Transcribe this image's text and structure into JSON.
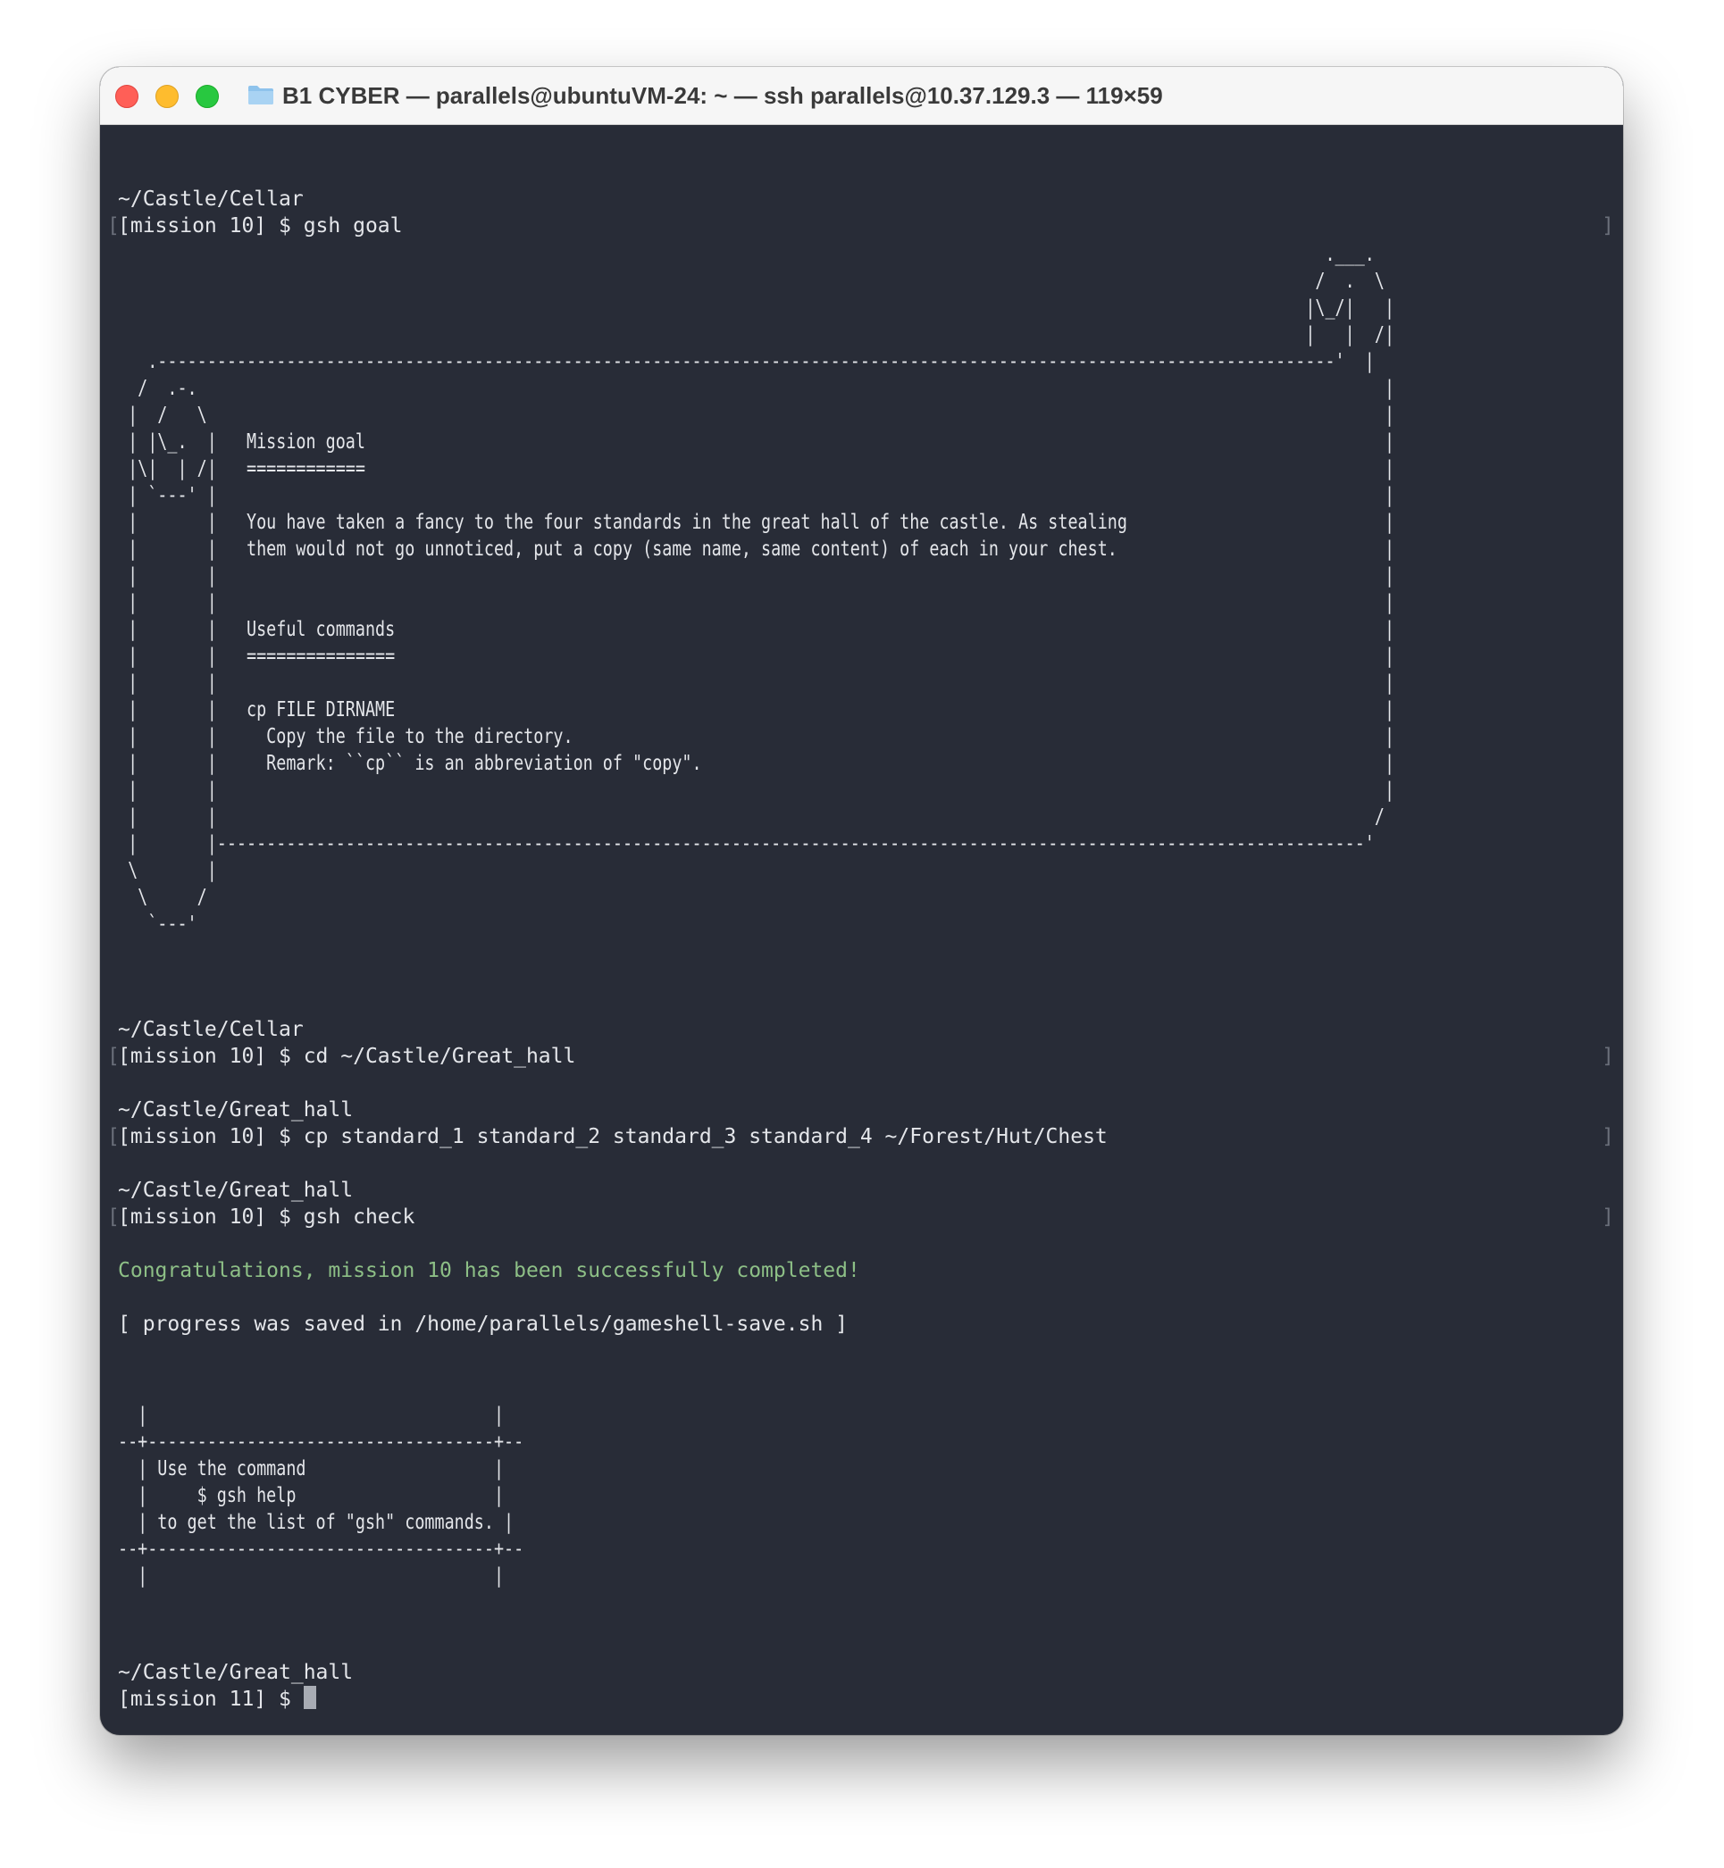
{
  "window": {
    "title": "B1 CYBER — parallels@ubuntuVM-24: ~ — ssh parallels@10.37.129.3 — 119×59",
    "folder_icon": "folder-icon",
    "controls": {
      "close_icon": "close-icon",
      "minimize_icon": "minimize-icon",
      "maximize_icon": "maximize-icon"
    }
  },
  "terminal": {
    "colors": {
      "background": "#282c37",
      "text": "#e4e6ea",
      "success": "#8dbf86",
      "bracket": "#6a6f7a"
    },
    "session1": {
      "path": "~/Castle/Cellar",
      "prompt": "[mission 10] $ gsh goal"
    },
    "goal_art": "                                                                                                                          .___.\n                                                                                                                         /  .  \\\n                                                                                                                        |\\_/|   |\n                                                                                                                        |   |  /|\n   .-----------------------------------------------------------------------------------------------------------------------'  |\n  /  .-.                                                                                                                        |\n |  /   \\                                                                                                                       |\n | |\\_.  |   Mission goal                                                                                                       |\n |\\|  | /|   ============                                                                                                       |\n | `---' |                                                                                                                      |\n |       |   You have taken a fancy to the four standards in the great hall of the castle. As stealing                          |\n |       |   them would not go unnoticed, put a copy (same name, same content) of each in your chest.                           |\n |       |                                                                                                                      |\n |       |                                                                                                                      |\n |       |   Useful commands                                                                                                    |\n |       |   ===============                                                                                                    |\n |       |                                                                                                                      |\n |       |   cp FILE DIRNAME                                                                                                    |\n |       |     Copy the file to the directory.                                                                                  |\n |       |     Remark: ``cp`` is an abbreviation of \"copy\".                                                                     |\n |       |                                                                                                                      |\n |       |                                                                                                                     /\n |       |--------------------------------------------------------------------------------------------------------------------'\n \\       |\n  \\     /\n   `---'",
    "session2": {
      "path": "~/Castle/Cellar",
      "prompt": "[mission 10] $ cd ~/Castle/Great_hall"
    },
    "session3": {
      "path": "~/Castle/Great_hall",
      "prompt": "[mission 10] $ cp standard_1 standard_2 standard_3 standard_4 ~/Forest/Hut/Chest"
    },
    "session4": {
      "path": "~/Castle/Great_hall",
      "prompt": "[mission 10] $ gsh check"
    },
    "success_message": "Congratulations, mission 10 has been successfully completed!",
    "progress_message": "[ progress was saved in /home/parallels/gameshell-save.sh ]",
    "help_art": "  |                                   |\n--+-----------------------------------+--\n  | Use the command                   |\n  |     $ gsh help                    |\n  | to get the list of \"gsh\" commands. |\n--+-----------------------------------+--\n  |                                   |",
    "session5": {
      "path": "~/Castle/Great_hall",
      "prompt": "[mission 11] $ "
    },
    "left_bracket": "[",
    "right_bracket": "]"
  }
}
